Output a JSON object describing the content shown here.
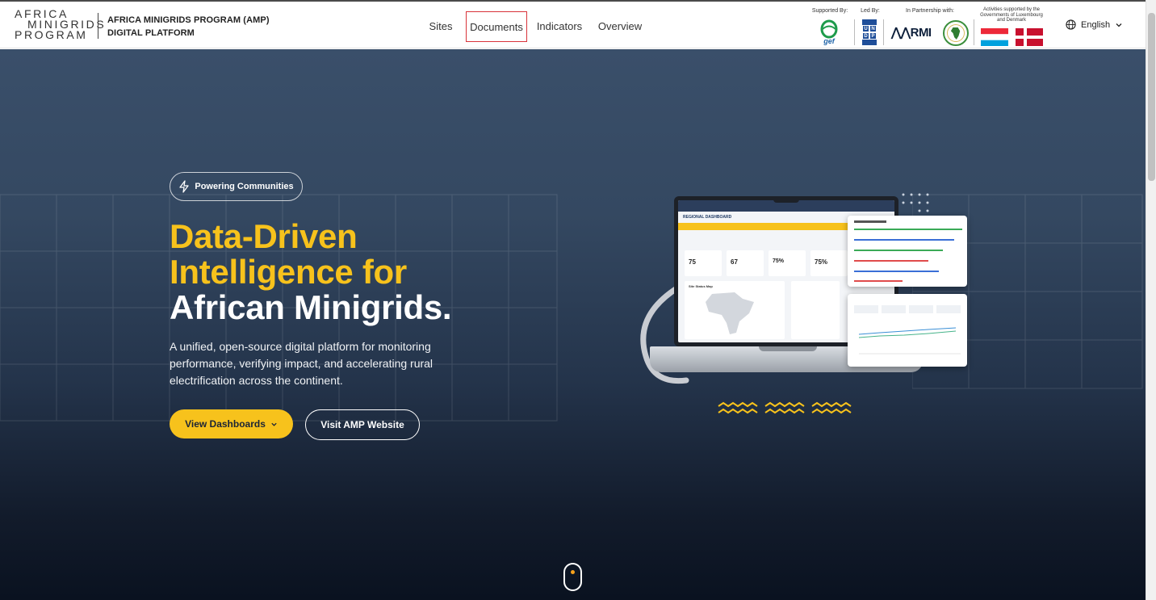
{
  "header": {
    "logo_lines": [
      "AFRICA",
      "MINIGRIDS",
      "PROGRAM"
    ],
    "title_line1": "AFRICA MINIGRIDS PROGRAM (AMP)",
    "title_line2": "DIGITAL PLATFORM",
    "nav": [
      {
        "label": "Sites",
        "active": false
      },
      {
        "label": "Documents",
        "active": true
      },
      {
        "label": "Indicators",
        "active": false
      },
      {
        "label": "Overview",
        "active": false
      }
    ],
    "partners": {
      "supported_by": "Supported By:",
      "led_by": "Led By:",
      "partnership": "In Partnership with:",
      "activities": "Activities supported by the Governments of Luxembourg and Denmark"
    },
    "partner_logos": {
      "gef": "gef",
      "undp": "UNDP",
      "rmi": "RMI"
    },
    "language": "English",
    "icons": {
      "language": "globe-icon",
      "language_caret": "chevron-down-icon"
    }
  },
  "hero": {
    "badge": "Powering Communities",
    "badge_icon": "lightning-icon",
    "headline_line1": "Data-Driven",
    "headline_line2": "Intelligence for",
    "headline_line3": "African Minigrids.",
    "description": "A unified, open-source digital platform for monitoring performance, verifying impact, and accelerating rural electrification across the continent.",
    "primary_button": "View Dashboards",
    "secondary_button": "Visit AMP Website",
    "scroll_icon": "mouse-scroll-icon"
  },
  "mockup": {
    "dashboard_title": "REGIONAL DASHBOARD",
    "stats": [
      "75",
      "67",
      "75%",
      "75%"
    ],
    "map_label": "Site Status Map"
  },
  "colors": {
    "accent": "#f7c21c",
    "hero_top": "#3a4f6a",
    "hero_bottom": "#0a1220",
    "active_nav_border": "#d9333a"
  }
}
